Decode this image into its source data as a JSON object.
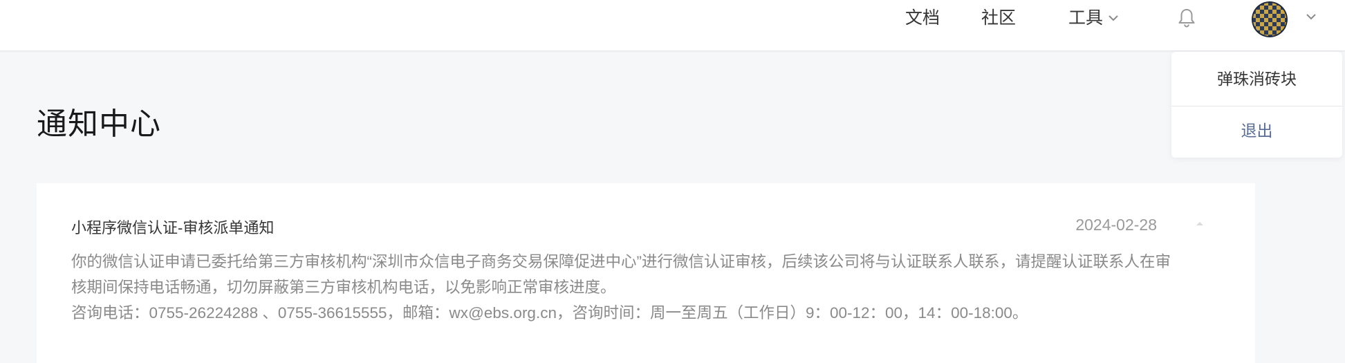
{
  "header": {
    "nav": {
      "docs": "文档",
      "community": "社区",
      "tools": "工具"
    },
    "icons": {
      "tools_dropdown": "chevron-down-icon",
      "notifications": "bell-icon",
      "user_dropdown": "chevron-down-icon"
    }
  },
  "user_menu": {
    "account_name": "弹珠消砖块",
    "logout": "退出"
  },
  "page": {
    "title": "通知中心"
  },
  "notifications": [
    {
      "title": "小程序微信认证-审核派单通知",
      "date": "2024-02-28",
      "body_line1": "你的微信认证申请已委托给第三方审核机构“深圳市众信电子商务交易保障促进中心”进行微信认证审核，后续该公司将与认证联系人联系，请提醒认证联系人在审核期间保持电话畅通，切勿屏蔽第三方审核机构电话，以免影响正常审核进度。",
      "body_line2": "咨询电话：0755-26224288 、0755-36615555，邮箱：wx@ebs.org.cn，咨询时间：周一至周五（工作日）9：00-12：00，14：00-18:00。"
    }
  ],
  "colors": {
    "page_bg": "#f6f7f9",
    "link": "#576b95",
    "muted_text": "#8a8a8a"
  }
}
